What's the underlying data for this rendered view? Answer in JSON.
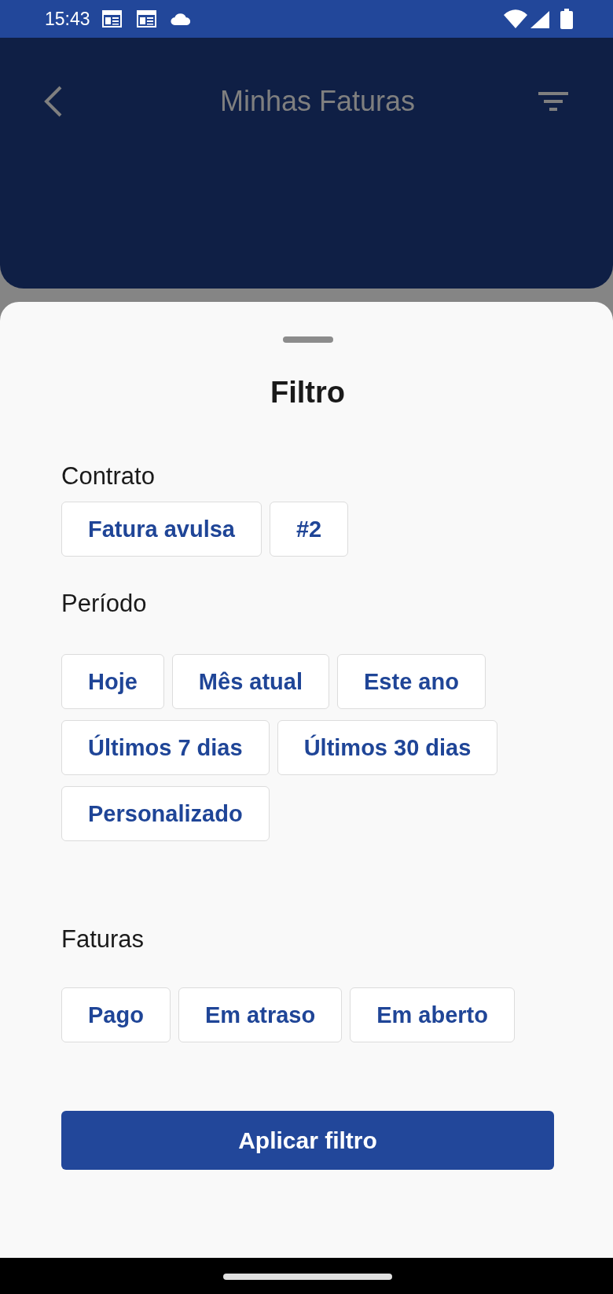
{
  "status_bar": {
    "time": "15:43"
  },
  "app_bar": {
    "title": "Minhas Faturas"
  },
  "sheet": {
    "title": "Filtro",
    "sections": [
      {
        "label": "Contrato",
        "options": [
          {
            "label": "Fatura avulsa",
            "selected": false
          },
          {
            "label": "#2",
            "selected": false
          }
        ]
      },
      {
        "label": "Período",
        "options": [
          {
            "label": "Hoje",
            "selected": false
          },
          {
            "label": "Mês atual",
            "selected": false
          },
          {
            "label": "Este ano",
            "selected": false
          },
          {
            "label": "Últimos 7 dias",
            "selected": false
          },
          {
            "label": "Últimos 30 dias",
            "selected": false
          },
          {
            "label": "Personalizado",
            "selected": false
          }
        ]
      },
      {
        "label": "Faturas",
        "options": [
          {
            "label": "Pago",
            "selected": false
          },
          {
            "label": "Em atraso",
            "selected": false
          },
          {
            "label": "Em aberto",
            "selected": false
          }
        ]
      }
    ],
    "apply_button": "Aplicar filtro"
  }
}
